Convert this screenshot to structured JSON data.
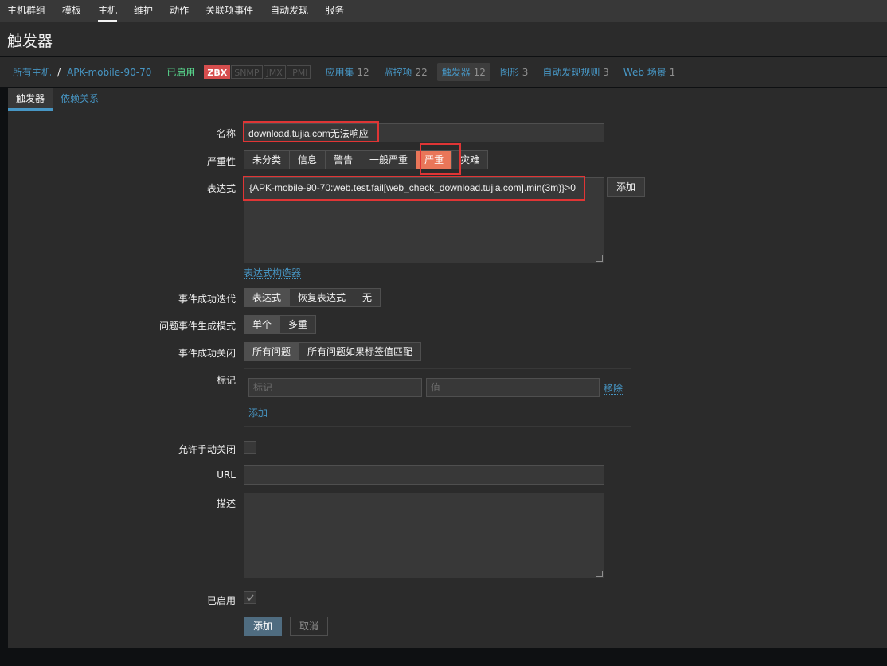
{
  "topnav": [
    "主机群组",
    "模板",
    "主机",
    "维护",
    "动作",
    "关联项事件",
    "自动发现",
    "服务"
  ],
  "page_title": "触发器",
  "breadcrumb": {
    "all_hosts": "所有主机",
    "separator": "/",
    "host": "APK-mobile-90-70",
    "enabled": "已启用",
    "availability": [
      "ZBX",
      "SNMP",
      "JMX",
      "IPMI"
    ],
    "links": [
      {
        "label": "应用集",
        "count": "12"
      },
      {
        "label": "监控项",
        "count": "22"
      },
      {
        "label": "触发器",
        "count": "12"
      },
      {
        "label": "图形",
        "count": "3"
      },
      {
        "label": "自动发现规则",
        "count": "3"
      },
      {
        "label": "Web 场景",
        "count": "1"
      }
    ]
  },
  "tabs": [
    "触发器",
    "依赖关系"
  ],
  "form": {
    "name_label": "名称",
    "name_value": "download.tujia.com无法响应",
    "severity_label": "严重性",
    "severity_options": [
      "未分类",
      "信息",
      "警告",
      "一般严重",
      "严重",
      "灾难"
    ],
    "expression_label": "表达式",
    "expression_value": "{APK-mobile-90-70:web.test.fail[web_check_download.tujia.com].min(3m)}>0",
    "expression_add": "添加",
    "expression_builder": "表达式构造器",
    "recovery_label": "事件成功迭代",
    "recovery_options": [
      "表达式",
      "恢复表达式",
      "无"
    ],
    "problem_mode_label": "问题事件生成模式",
    "problem_mode_options": [
      "单个",
      "多重"
    ],
    "ok_close_label": "事件成功关闭",
    "ok_close_options": [
      "所有问题",
      "所有问题如果标签值匹配"
    ],
    "tags_label": "标记",
    "tag_placeholder": "标记",
    "value_placeholder": "值",
    "tag_remove": "移除",
    "tag_add": "添加",
    "manual_close_label": "允许手动关闭",
    "url_label": "URL",
    "description_label": "描述",
    "enabled_label": "已启用",
    "submit": "添加",
    "cancel": "取消"
  }
}
